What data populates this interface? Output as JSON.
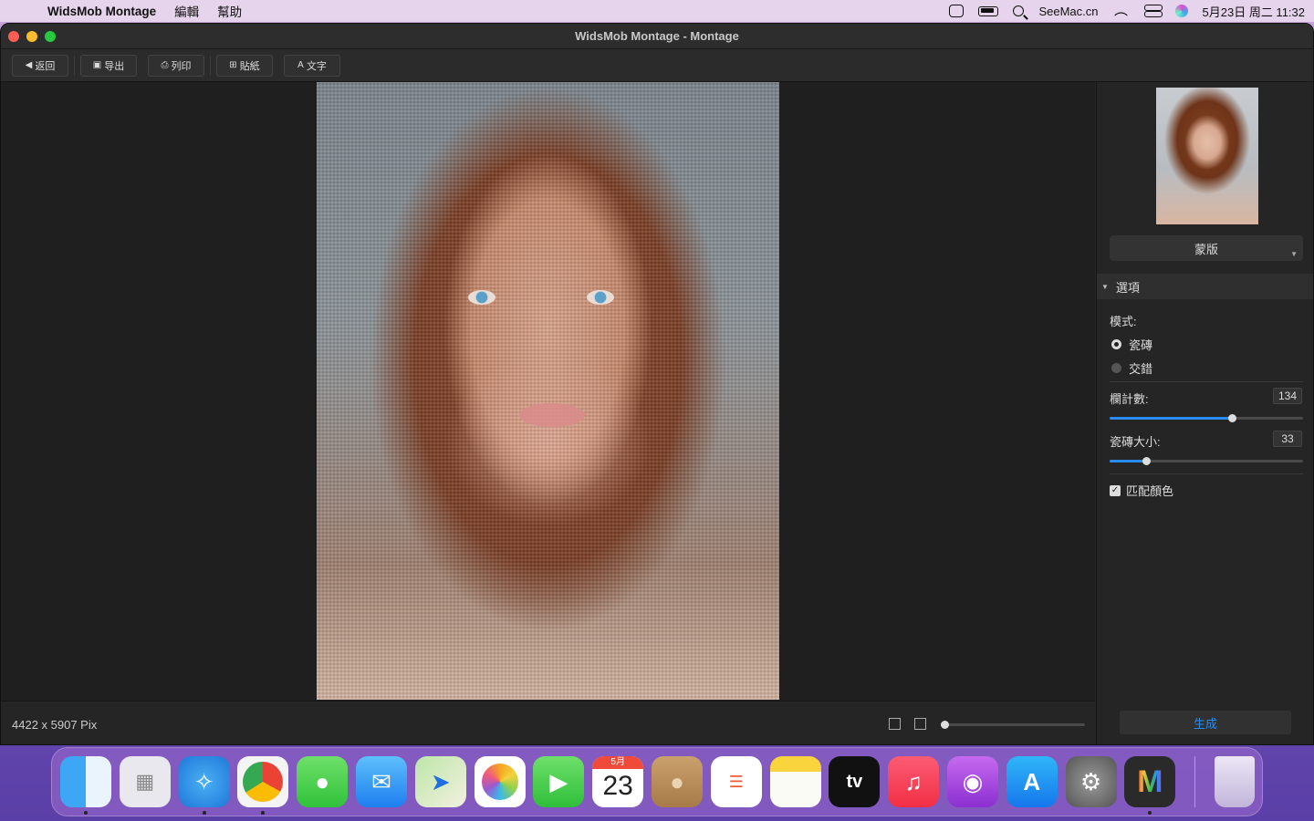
{
  "menubar": {
    "app_name": "WidsMob Montage",
    "items": [
      "編輯",
      "幫助"
    ],
    "site": "SeeMac.cn",
    "datetime": "5月23日 周二  11:32"
  },
  "window": {
    "title": "WidsMob Montage - Montage"
  },
  "toolbar": {
    "back": "返回",
    "export": "导出",
    "print": "列印",
    "sticker": "貼紙",
    "text": "文字"
  },
  "sidebar": {
    "mask_label": "蒙版",
    "options_header": "選項",
    "mode_label": "模式:",
    "mode_options": [
      "瓷磚",
      "交錯"
    ],
    "mode_selected": "瓷磚",
    "columns_label": "欄計數:",
    "columns_value": "134",
    "tile_size_label": "瓷磚大小:",
    "tile_size_value": "33",
    "match_color_label": "匹配顏色",
    "match_color_checked": true
  },
  "status": {
    "dimensions": "4422 x 5907 Pix"
  },
  "generate_label": "生成",
  "dock": {
    "apps": [
      "finder",
      "launchpad",
      "safari",
      "chrome",
      "messages",
      "mail",
      "maps",
      "photos",
      "facetime",
      "calendar",
      "contacts",
      "reminders",
      "notes",
      "appletv",
      "music",
      "podcasts",
      "appstore",
      "system-preferences",
      "widsmob-montage",
      "trash"
    ],
    "calendar_month": "5月",
    "calendar_day": "23"
  },
  "colors": {
    "accent": "#2a8cf0",
    "window_bg": "#252525"
  }
}
